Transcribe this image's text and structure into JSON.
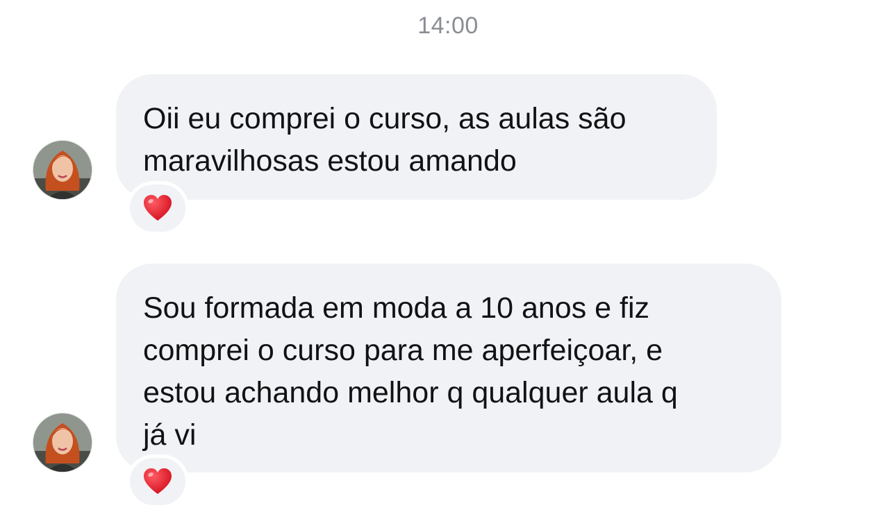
{
  "chat": {
    "timestamp": "14:00",
    "messages": [
      {
        "lines": [
          "Oii eu comprei o curso, as aulas são",
          "maravilhosas estou amando"
        ],
        "reaction": "heart-emoji"
      },
      {
        "lines": [
          "Sou formada em moda a 10 anos e fiz",
          "comprei o curso para me aperfeiçoar, e",
          "estou achando melhor q qualquer aula q",
          "já vi"
        ],
        "reaction": "heart-emoji"
      }
    ]
  },
  "colors": {
    "bubble_bg": "#f1f2f5",
    "timestamp": "#8a8d93",
    "text": "#111214",
    "reaction_heart": "#e0202e"
  }
}
